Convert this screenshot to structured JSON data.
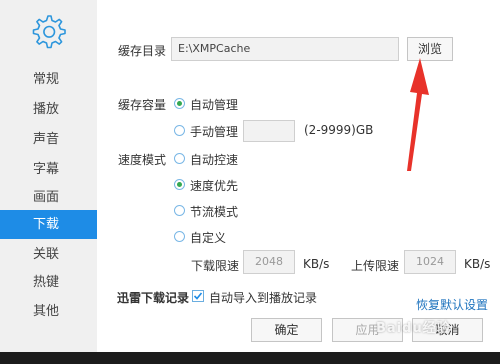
{
  "sidebar": {
    "items": [
      {
        "label": "常规"
      },
      {
        "label": "播放"
      },
      {
        "label": "声音"
      },
      {
        "label": "字幕"
      },
      {
        "label": "画面"
      },
      {
        "label": "下载"
      },
      {
        "label": "关联"
      },
      {
        "label": "热键"
      },
      {
        "label": "其他"
      }
    ],
    "active_index": 5
  },
  "cache_dir": {
    "label": "缓存目录",
    "value": "E:\\XMPCache",
    "browse_label": "浏览"
  },
  "cache_size": {
    "label": "缓存容量",
    "auto_label": "自动管理",
    "manual_label": "手动管理",
    "manual_value": "",
    "range_label": "(2-9999)GB",
    "selected": "auto"
  },
  "speed_mode": {
    "label": "速度模式",
    "options": [
      "自动控速",
      "速度优先",
      "节流模式",
      "自定义"
    ],
    "selected_index": 1,
    "download_limit_label": "下载限速",
    "download_limit_value": "2048",
    "download_unit": "KB/s",
    "upload_limit_label": "上传限速",
    "upload_limit_value": "1024",
    "upload_unit": "KB/s"
  },
  "thunder": {
    "label": "迅雷下载记录",
    "checkbox_label": "自动导入到播放记录",
    "checked": true
  },
  "footer": {
    "restore_label": "恢复默认设置",
    "ok_label": "确定",
    "apply_label": "应用",
    "cancel_label": "取消"
  },
  "watermark": "Baidu经验",
  "colors": {
    "accent": "#1e8ce6",
    "arrow": "#e8322a",
    "radio_selected": "#34a853"
  }
}
